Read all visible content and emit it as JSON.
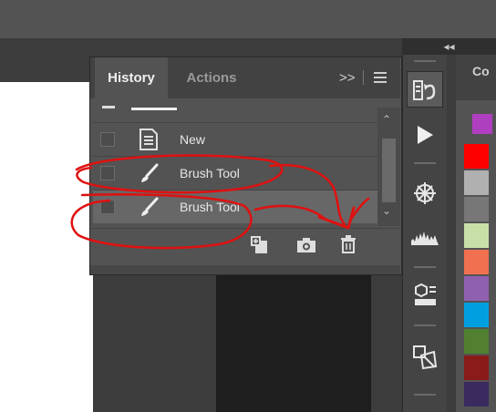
{
  "history_panel": {
    "tabs": [
      {
        "label": "History"
      },
      {
        "label": "Actions"
      }
    ],
    "menu_glyph": ">>",
    "items": [
      {
        "label": "New",
        "icon": "document-icon"
      },
      {
        "label": "Brush Tool",
        "icon": "brush-icon"
      },
      {
        "label": "Brush Tool",
        "icon": "brush-icon"
      }
    ],
    "footer": {
      "new_document_icon": "new-document-from-state-icon",
      "snapshot_icon": "camera-icon",
      "delete_icon": "trash-icon"
    }
  },
  "toolbar": {
    "collapse_glyph": "◂◂"
  },
  "color_panel": {
    "tab_label": "Co",
    "swatches": [
      "#ff0000",
      "#b0b0b0",
      "#777777",
      "#c8e0a8",
      "#f07050",
      "#9060b0",
      "#00a0e0",
      "#508030",
      "#8b1a1a",
      "#3a2a60"
    ],
    "selected_color": "#b03ec0"
  },
  "colors": {
    "annotation_red": "#e01010",
    "panel": "#535353",
    "selected_row": "#676767"
  }
}
